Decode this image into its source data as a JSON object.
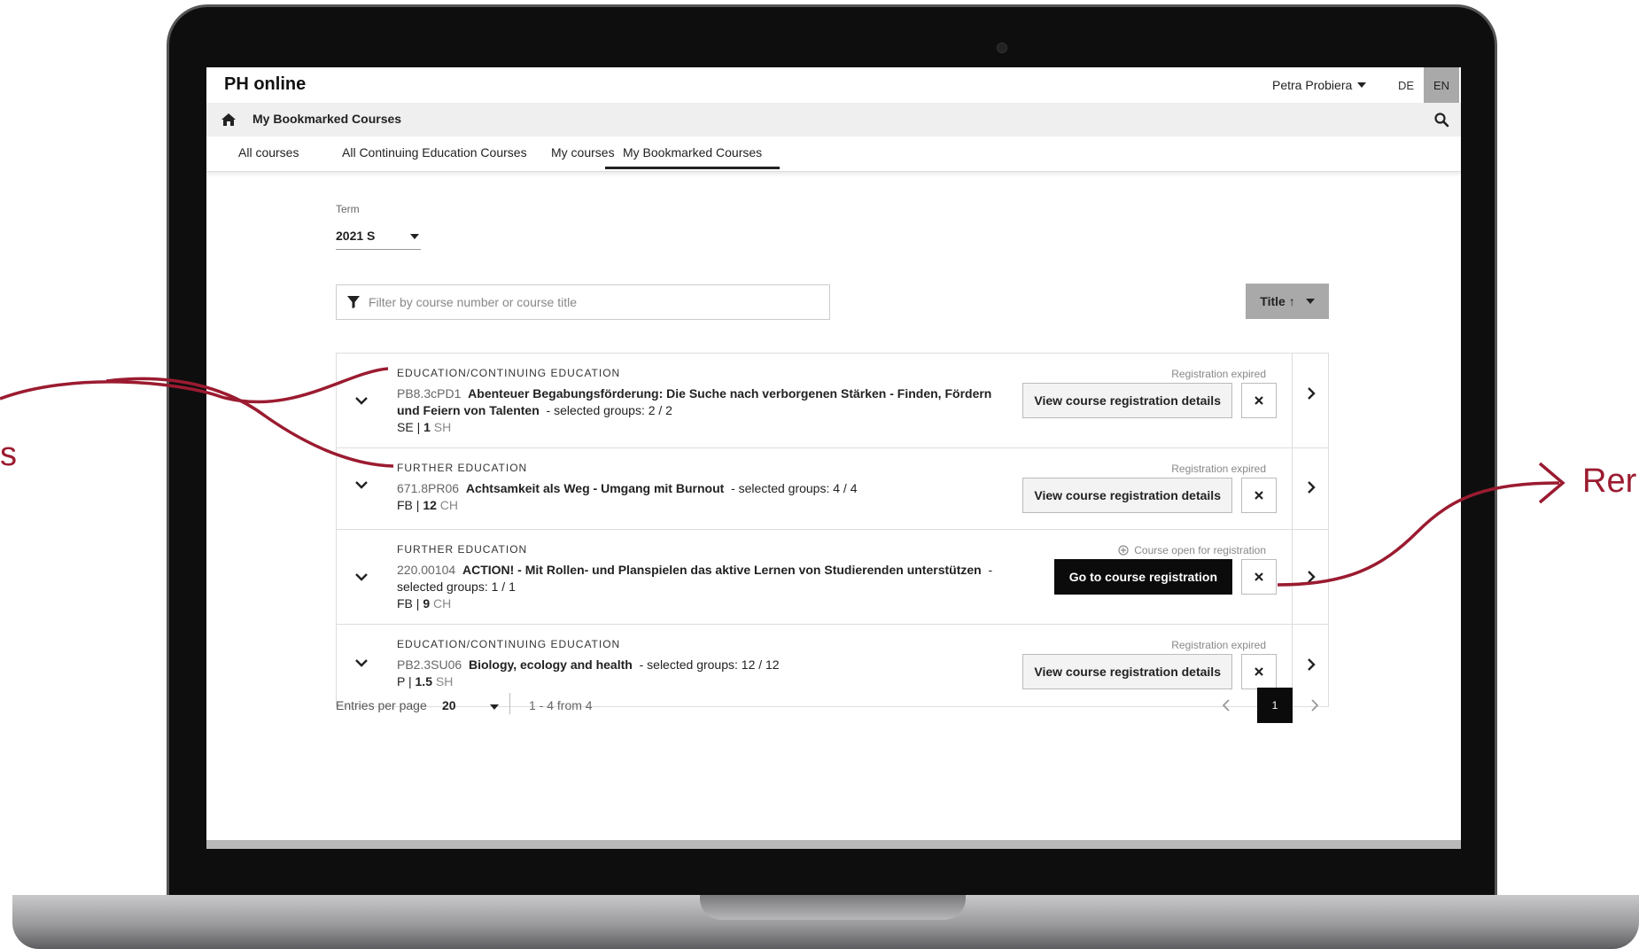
{
  "app": {
    "brand": "PH online",
    "user_name": "Petra Probiera",
    "languages": [
      "DE",
      "EN"
    ],
    "active_language": "EN"
  },
  "breadcrumb": {
    "title": "My Bookmarked Courses"
  },
  "tabs": [
    {
      "label": "All courses"
    },
    {
      "label": "All Continuing Education Courses"
    },
    {
      "label": "My courses"
    },
    {
      "label": "My Bookmarked Courses",
      "active": true
    }
  ],
  "term": {
    "label": "Term",
    "value": "2021 S"
  },
  "filter": {
    "placeholder": "Filter by course number or course title"
  },
  "sort": {
    "label": "Title ↑"
  },
  "courses": [
    {
      "category": "EDUCATION/CONTINUING EDUCATION",
      "number": "PB8.3cPD1",
      "title": "Abenteuer Begabungsförderung: Die Suche nach verborgenen Stärken - Finden, Fördern und Feiern von Talenten",
      "groups": "-   selected groups: 2 / 2",
      "type": "SE",
      "credits": "1",
      "unit": "SH",
      "status": "Registration expired",
      "action": "View course registration details"
    },
    {
      "category": "FURTHER EDUCATION",
      "number": "671.8PR06",
      "title": "Achtsamkeit als Weg - Umgang mit Burnout",
      "groups": "-   selected groups: 4 / 4",
      "type": "FB",
      "credits": "12",
      "unit": "CH",
      "status": "Registration expired",
      "action": "View course registration details"
    },
    {
      "category": "FURTHER EDUCATION",
      "number": "220.00104",
      "title": "ACTION! - Mit Rollen- und Planspielen das aktive Lernen von Studierenden unterstützen",
      "groups": "-   selected groups: 1 / 1",
      "type": "FB",
      "credits": "9",
      "unit": "CH",
      "status": "Course open for registration",
      "action": "Go to course registration"
    },
    {
      "category": "EDUCATION/CONTINUING EDUCATION",
      "number": "PB2.3SU06",
      "title": "Biology, ecology and health",
      "groups": "-   selected groups: 12 / 12",
      "type": "P",
      "credits": "1.5",
      "unit": "SH",
      "status": "Registration expired",
      "action": "View course registration details"
    }
  ],
  "pagination": {
    "entries_label": "Entries per page",
    "entries_value": "20",
    "range": "1 - 4 from 4",
    "current_page": "1"
  },
  "annotations": {
    "left_fragment": "s",
    "right_fragment": "Rer"
  },
  "colors": {
    "annotation": "#9b1b30",
    "primary_button": "#0b0b0b",
    "active_tab_bg": "#a9a9a9"
  }
}
